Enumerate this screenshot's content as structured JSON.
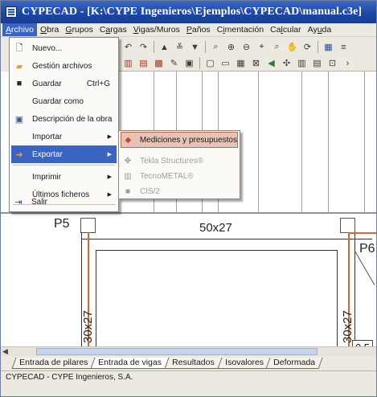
{
  "window": {
    "title": "CYPECAD - [K:\\CYPE Ingenieros\\Ejemplos\\CYPECAD\\manual.c3e]"
  },
  "menubar": [
    {
      "id": "archivo",
      "pre": "",
      "u": "A",
      "post": "rchivo"
    },
    {
      "id": "obra",
      "pre": "",
      "u": "O",
      "post": "bra"
    },
    {
      "id": "grupos",
      "pre": "",
      "u": "G",
      "post": "rupos"
    },
    {
      "id": "cargas",
      "pre": "C",
      "u": "a",
      "post": "rgas"
    },
    {
      "id": "vigas",
      "pre": "",
      "u": "V",
      "post": "igas/Muros"
    },
    {
      "id": "panos",
      "pre": "",
      "u": "P",
      "post": "años"
    },
    {
      "id": "cimentacion",
      "pre": "C",
      "u": "i",
      "post": "mentación"
    },
    {
      "id": "calcular",
      "pre": "Ca",
      "u": "l",
      "post": "cular"
    },
    {
      "id": "ayuda",
      "pre": "Ay",
      "u": "u",
      "post": "da"
    }
  ],
  "archivo_menu": {
    "items": [
      {
        "label": "Nuevo...",
        "shortcut": "",
        "icon": "new-document-icon",
        "arrow": ""
      },
      {
        "label": "Gestión archivos",
        "shortcut": "",
        "icon": "open-folder-icon",
        "arrow": ""
      },
      {
        "label": "Guardar",
        "shortcut": "Ctrl+G",
        "icon": "save-disk-icon",
        "arrow": ""
      },
      {
        "label": "Guardar como",
        "shortcut": "",
        "icon": "",
        "arrow": ""
      },
      {
        "label": "Descripción de la obra",
        "shortcut": "",
        "icon": "building-description-icon",
        "arrow": ""
      },
      {
        "label": "Importar",
        "shortcut": "",
        "icon": "",
        "arrow": "▶"
      },
      {
        "label": "Exportar",
        "shortcut": "",
        "icon": "export-icon",
        "arrow": "▶"
      },
      {
        "label": "Imprimir",
        "shortcut": "",
        "icon": "",
        "arrow": "▶"
      },
      {
        "label": "Últimos ficheros",
        "shortcut": "",
        "icon": "",
        "arrow": "▶"
      },
      {
        "label": "Salir",
        "shortcut": "",
        "icon": "exit-door-icon",
        "arrow": ""
      }
    ]
  },
  "exportar_submenu": {
    "items": [
      {
        "label": "Mediciones y presupuestos",
        "icon": "budget-icon"
      },
      {
        "label": "Tekla Structures®",
        "icon": "tekla-icon"
      },
      {
        "label": "TecnoMETAL®",
        "icon": "tecnometal-icon"
      },
      {
        "label": "CIS/2",
        "icon": "cis2-icon"
      }
    ]
  },
  "canvas": {
    "pillar_1": "P5",
    "pillar_2": "P6",
    "beam_horizontal": "50x27",
    "beam_vertical_1": "30x27",
    "beam_vertical_2": "30x27",
    "scale_value": "0.5"
  },
  "tabs": [
    {
      "label": "Entrada de pilares"
    },
    {
      "label": "Entrada de vigas"
    },
    {
      "label": "Resultados"
    },
    {
      "label": "Isovalores"
    },
    {
      "label": "Deformada"
    }
  ],
  "status": {
    "text": "CYPECAD - CYPE Ingenieros, S.A."
  }
}
